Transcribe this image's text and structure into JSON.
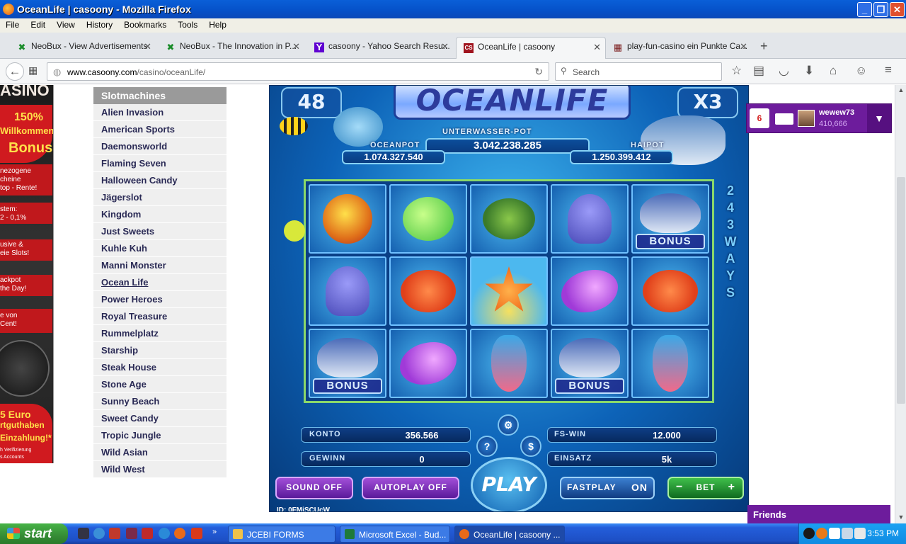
{
  "window": {
    "title": "OceanLife | casoony - Mozilla Firefox"
  },
  "menu": [
    "File",
    "Edit",
    "View",
    "History",
    "Bookmarks",
    "Tools",
    "Help"
  ],
  "tabs": [
    {
      "label": "NeoBux - View Advertisements",
      "icon": "✖"
    },
    {
      "label": "NeoBux - The Innovation in P...",
      "icon": "✖"
    },
    {
      "label": "casoony - Yahoo Search Resu...",
      "icon": "Y"
    },
    {
      "label": "OceanLife | casoony",
      "icon": "CS"
    },
    {
      "label": "play-fun-casino ein Punkte Ca...",
      "icon": "▦"
    }
  ],
  "nav": {
    "url_domain": "www.casoony.com",
    "url_path": "/casino/oceanLife/",
    "search_placeholder": "Search"
  },
  "banner": {
    "top": "ASINO",
    "bonus_pct": "150%",
    "bonus_line1": "Willkommens",
    "bonus_line2": "Bonus!",
    "l1a": "nezogene",
    "l1b": "cheine",
    "l1c": "top - Rente!",
    "l2a": "stem:",
    "l2b": "2 - 0,1%",
    "l3a": "usive &",
    "l3b": "eie Slots!",
    "l4a": "ackpot",
    "l4b": "the Day!",
    "l5a": "e von",
    "l5b": "Cent!",
    "l6a": "5 Euro",
    "l6b": "rtguthaben",
    "l6c": "Einzahlung!*",
    "l6d": "h Verifizierung",
    "l6e": "s Accounts"
  },
  "sidebar": {
    "header": "Slotmachines",
    "items": [
      "Alien Invasion",
      "American Sports",
      "Daemonsworld",
      "Flaming Seven",
      "Halloween Candy",
      "Jägerslot",
      "Kingdom",
      "Just Sweets",
      "Kuhle Kuh",
      "Manni Monster",
      "Ocean Life",
      "Power Heroes",
      "Royal Treasure",
      "Rummelplatz",
      "Starship",
      "Steak House",
      "Stone Age",
      "Sunny Beach",
      "Sweet Candy",
      "Tropic Jungle",
      "Wild Asian",
      "Wild West"
    ],
    "current": "Ocean Life"
  },
  "game": {
    "logo": "OCEANLIFE",
    "left_corner": "48",
    "right_corner": "X3",
    "pot_title": "UNTERWASSER-POT",
    "pot_value": "3.042.238.285",
    "oceanpot_label": "OCEANPOT",
    "oceanpot_value": "1.074.327.540",
    "haipot_label": "HAIPOT",
    "haipot_value": "1.250.399.412",
    "ways": [
      "2",
      "4",
      "3",
      "W",
      "A",
      "Y",
      "S"
    ],
    "reels": [
      [
        "diver",
        "pufferfish",
        "turtle",
        "octopus",
        "shark-bonus"
      ],
      [
        "octopus",
        "crab",
        "starfish",
        "ray",
        "crab"
      ],
      [
        "shark-bonus",
        "ray",
        "seahorse",
        "shark-bonus",
        "seahorse"
      ]
    ],
    "bonus_label": "BONUS",
    "konto_label": "KONTO",
    "konto_value": "356.566",
    "gewinn_label": "GEWINN",
    "gewinn_value": "0",
    "fswin_label": "FS-WIN",
    "fswin_value": "12.000",
    "einsatz_label": "EINSATZ",
    "einsatz_value": "5k",
    "sound_label": "SOUND OFF",
    "autoplay_label": "AUTOPLAY OFF",
    "play_label": "PLAY",
    "fastplay_label": "FASTPLAY",
    "fastplay_state": "ON",
    "bet_label": "BET",
    "id_text": "ID: 0FMiSCUcW"
  },
  "friendsbar": {
    "badge": "6",
    "username": "wewew73",
    "points": "410,666",
    "friends_label": "Friends"
  },
  "taskbar": {
    "start": "start",
    "items": [
      {
        "label": "JCEBI FORMS"
      },
      {
        "label": "Microsoft Excel - Bud..."
      },
      {
        "label": "OceanLife | casoony ..."
      }
    ],
    "clock": "3:53 PM"
  }
}
